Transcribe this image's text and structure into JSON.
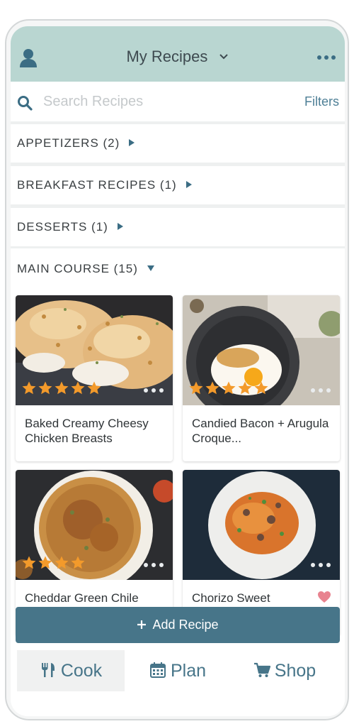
{
  "header": {
    "title": "My Recipes",
    "icons": {
      "user": "user-icon",
      "dropdown": "chevron-down-icon",
      "more": "more-horizontal-icon"
    }
  },
  "search": {
    "placeholder": "Search Recipes",
    "value": "",
    "filters_label": "Filters"
  },
  "categories": [
    {
      "label": "APPETIZERS (2)",
      "expanded": false
    },
    {
      "label": "BREAKFAST RECIPES (1)",
      "expanded": false
    },
    {
      "label": "DESSERTS (1)",
      "expanded": false
    },
    {
      "label": "MAIN COURSE (15)",
      "expanded": true
    }
  ],
  "recipes": [
    {
      "name": "Baked Creamy Cheesy Chicken Breasts",
      "rating": 5,
      "favorite": false
    },
    {
      "name": "Candied Bacon + Arugula Croque...",
      "rating": 5,
      "favorite": false
    },
    {
      "name": "Cheddar Green Chile",
      "rating": 4,
      "favorite": false
    },
    {
      "name": "Chorizo Sweet",
      "rating": 0,
      "favorite": true
    }
  ],
  "add_button": {
    "label": "Add Recipe"
  },
  "tabs": [
    {
      "label": "Cook",
      "icon": "utensils-icon",
      "active": true
    },
    {
      "label": "Plan",
      "icon": "calendar-icon",
      "active": false
    },
    {
      "label": "Shop",
      "icon": "cart-icon",
      "active": false
    }
  ],
  "colors": {
    "header_bg": "#b9d6d1",
    "accent": "#477589",
    "star": "#f39a2b",
    "heart": "#e8838f"
  }
}
